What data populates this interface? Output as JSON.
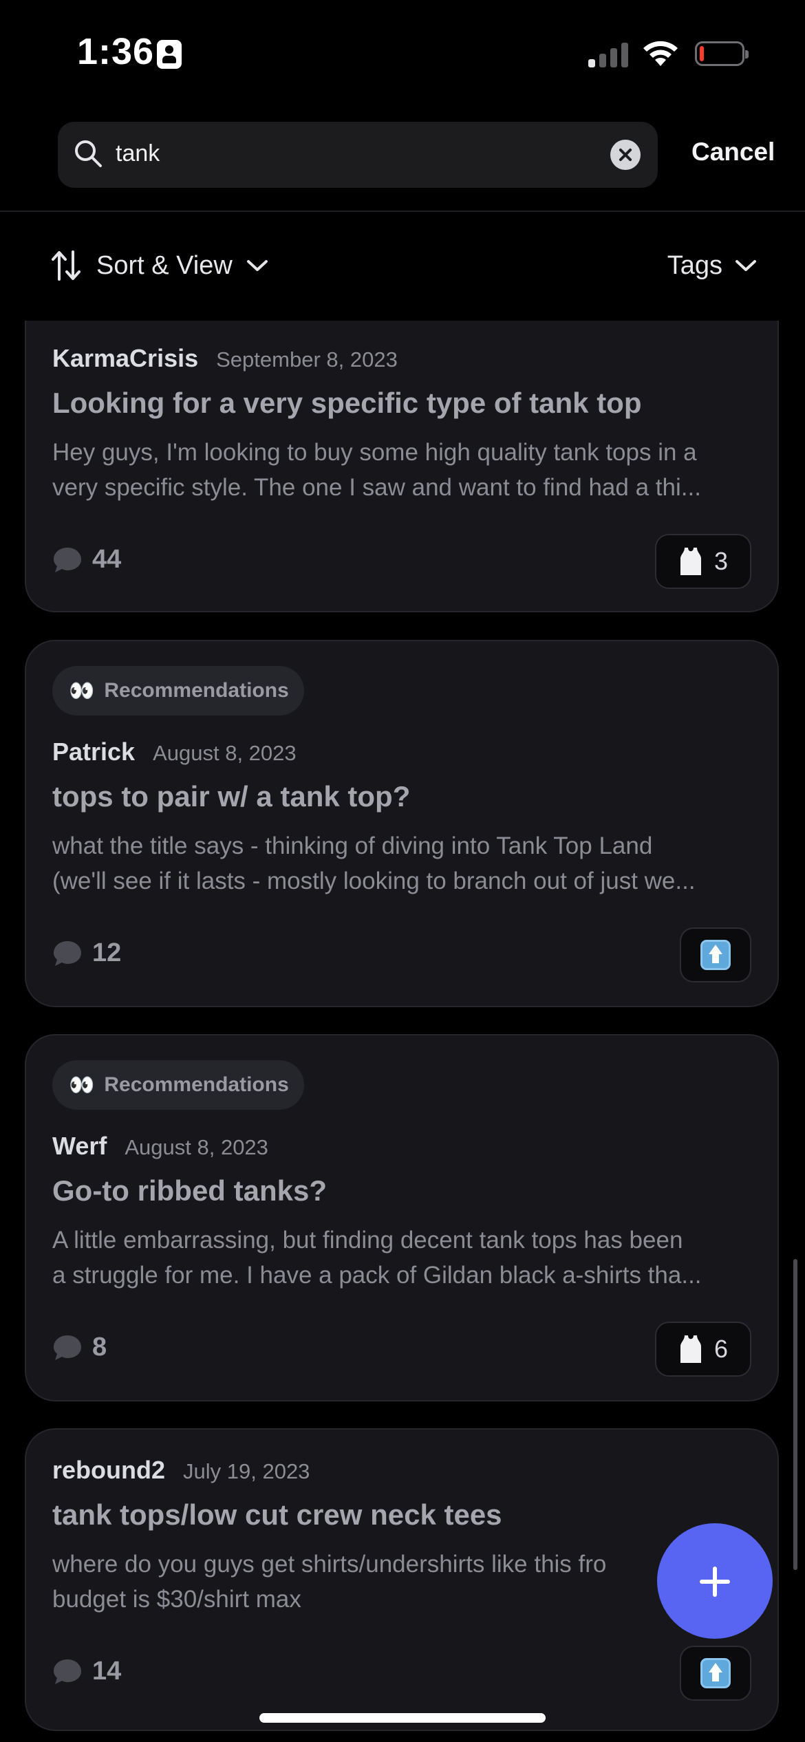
{
  "status_bar": {
    "time": "1:36",
    "icons": [
      "contact-badge-icon",
      "cellular-signal-icon",
      "wifi-icon",
      "battery-icon"
    ],
    "battery_color": "#ff3b30"
  },
  "search": {
    "query": "tank",
    "cancel_label": "Cancel"
  },
  "toolbar": {
    "sort_label": "Sort & View",
    "tags_label": "Tags"
  },
  "posts": [
    {
      "tag": "",
      "author": "KarmaCrisis",
      "date": "September 8, 2023",
      "title": "Looking for a very specific type of tank top",
      "excerpt_line1": "Hey guys, I'm looking to buy some high quality tank tops in a",
      "excerpt_line2": "very specific style. The one I saw and want to find had a thi...",
      "comments": "44",
      "reaction_emoji": "tank-top-emoji",
      "reaction_count": "3"
    },
    {
      "tag": "Recommendations",
      "tag_emoji": "👀",
      "author": "Patrick",
      "date": "August 8, 2023",
      "title": "tops to pair w/ a tank top?",
      "excerpt_line1": "what the title says - thinking of diving into Tank Top Land",
      "excerpt_line2": "(we'll see if it lasts - mostly looking to branch out of just we...",
      "comments": "12",
      "reaction_emoji": "up-arrow-emoji",
      "reaction_count": ""
    },
    {
      "tag": "Recommendations",
      "tag_emoji": "👀",
      "author": "Werf",
      "date": "August 8, 2023",
      "title": "Go-to ribbed tanks?",
      "excerpt_line1": "A little embarrassing, but finding decent tank tops has been",
      "excerpt_line2": "a struggle for me. I have a pack of Gildan black a-shirts tha...",
      "comments": "8",
      "reaction_emoji": "tank-top-emoji",
      "reaction_count": "6"
    },
    {
      "tag": "",
      "author": "rebound2",
      "date": "July 19, 2023",
      "title": "tank tops/low cut crew neck tees",
      "excerpt_line1": "where do you guys get shirts/undershirts like this fro",
      "excerpt_line2": "budget is $30/shirt max",
      "comments": "14",
      "reaction_emoji": "up-arrow-emoji",
      "reaction_count": ""
    }
  ],
  "colors": {
    "background": "#000000",
    "card": "#16161b",
    "accent": "#5865f2"
  }
}
